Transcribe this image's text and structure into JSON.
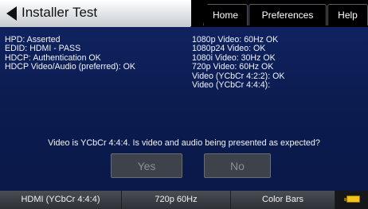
{
  "header": {
    "title": "Installer Test",
    "tabs": [
      "Home",
      "Preferences",
      "Help"
    ]
  },
  "status_left": [
    "HPD: Asserted",
    "EDID: HDMI - PASS",
    "HDCP: Authentication OK",
    "HDCP Video/Audio (preferred): OK"
  ],
  "status_right": [
    "1080p Video: 60Hz OK",
    "1080p24 Video: OK",
    "1080i Video: 30Hz OK",
    "720p Video: 60Hz OK",
    "Video (YCbCr 4:2:2): OK",
    "Video (YCbCr 4:4:4):"
  ],
  "prompt": {
    "question": "Video is YCbCr 4:4:4. Is video and audio being presented as expected?",
    "yes_label": "Yes",
    "no_label": "No"
  },
  "statusbar": {
    "interface": "HDMI (YCbCr 4:4:4)",
    "resolution": "720p 60Hz",
    "image": "Color Bars",
    "battery_icon": "battery-icon"
  },
  "colors": {
    "background": "#0d1d52",
    "title_bar": "#dfe2e6",
    "battery": "#f4c21b"
  }
}
